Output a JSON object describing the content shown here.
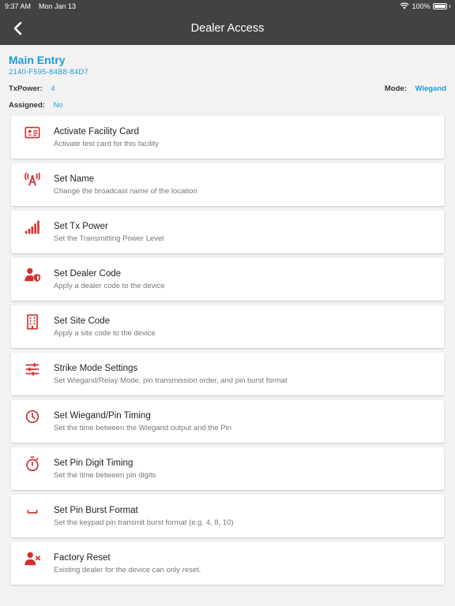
{
  "status_bar": {
    "time": "9:37 AM",
    "date": "Mon Jan 13",
    "battery": "100%"
  },
  "nav": {
    "title": "Dealer Access"
  },
  "device": {
    "name": "Main Entry",
    "id": "2140-F595-84B8-84D7",
    "txpower_label": "TxPower:",
    "txpower_value": "4",
    "mode_label": "Mode:",
    "mode_value": "Wiegand",
    "assigned_label": "Assigned:",
    "assigned_value": "No"
  },
  "colors": {
    "accent": "#1a9ed9",
    "icon": "#d32f2f",
    "header": "#424242"
  },
  "menu": [
    {
      "icon": "id-card-icon",
      "title": "Activate Facility Card",
      "subtitle": "Activate test card for this facility"
    },
    {
      "icon": "broadcast-icon",
      "title": "Set Name",
      "subtitle": "Change the broadcast name of the location"
    },
    {
      "icon": "signal-bars-icon",
      "title": "Set Tx Power",
      "subtitle": "Set the Transmitting Power Level"
    },
    {
      "icon": "user-shield-icon",
      "title": "Set Dealer Code",
      "subtitle": "Apply a dealer code to the device"
    },
    {
      "icon": "building-icon",
      "title": "Set Site Code",
      "subtitle": "Apply a site code to the device"
    },
    {
      "icon": "sliders-icon",
      "title": "Strike Mode Settings",
      "subtitle": "Set Wiegand/Relay Mode, pin transmission order, and pin burst format"
    },
    {
      "icon": "clock-icon",
      "title": "Set Wiegand/Pin Timing",
      "subtitle": "Set the time between the Wiegand output and the Pin"
    },
    {
      "icon": "stopwatch-icon",
      "title": "Set Pin Digit Timing",
      "subtitle": "Set the time between pin digits"
    },
    {
      "icon": "space-bar-icon",
      "title": "Set Pin Burst Format",
      "subtitle": "Set the keypad pin transmit burst format (e.g. 4, 8, 10)"
    },
    {
      "icon": "user-remove-icon",
      "title": "Factory Reset",
      "subtitle": "Existing dealer for the device can only reset."
    }
  ]
}
